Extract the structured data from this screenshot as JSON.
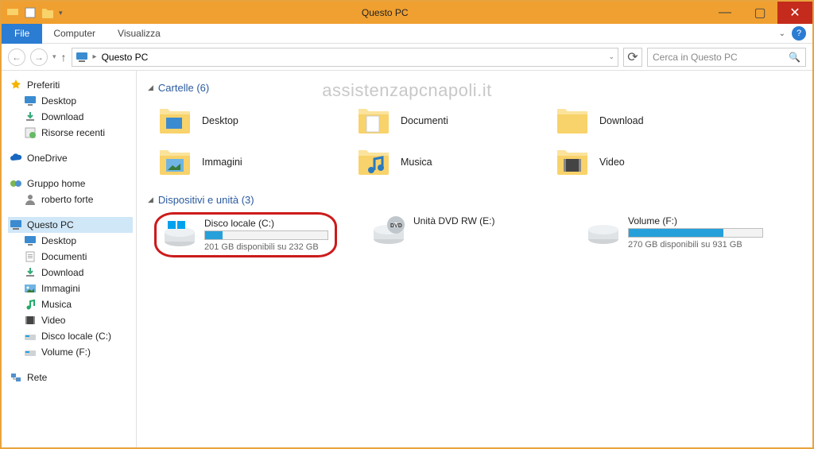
{
  "window": {
    "title": "Questo PC"
  },
  "ribbon": {
    "file": "File",
    "tabs": [
      "Computer",
      "Visualizza"
    ]
  },
  "address": {
    "location": "Questo PC"
  },
  "search": {
    "placeholder": "Cerca in Questo PC"
  },
  "watermark": "assistenzapcnapoli.it",
  "sidebar": {
    "favorites": {
      "label": "Preferiti",
      "items": [
        "Desktop",
        "Download",
        "Risorse recenti"
      ]
    },
    "onedrive": "OneDrive",
    "homegroup": {
      "label": "Gruppo home",
      "items": [
        "roberto forte"
      ]
    },
    "thispc": {
      "label": "Questo PC",
      "items": [
        "Desktop",
        "Documenti",
        "Download",
        "Immagini",
        "Musica",
        "Video",
        "Disco locale (C:)",
        "Volume (F:)"
      ]
    },
    "network": "Rete"
  },
  "sections": {
    "folders": {
      "header": "Cartelle (6)",
      "items": [
        "Desktop",
        "Documenti",
        "Download",
        "Immagini",
        "Musica",
        "Video"
      ]
    },
    "devices": {
      "header": "Dispositivi e unità (3)",
      "drives": [
        {
          "name": "Disco locale (C:)",
          "sub": "201 GB disponibili su 232 GB",
          "fill_pct": 14,
          "circled": true
        },
        {
          "name": "Unità DVD RW (E:)",
          "sub": "",
          "fill_pct": null,
          "circled": false
        },
        {
          "name": "Volume (F:)",
          "sub": "270 GB disponibili su 931 GB",
          "fill_pct": 71,
          "circled": false
        }
      ]
    }
  }
}
